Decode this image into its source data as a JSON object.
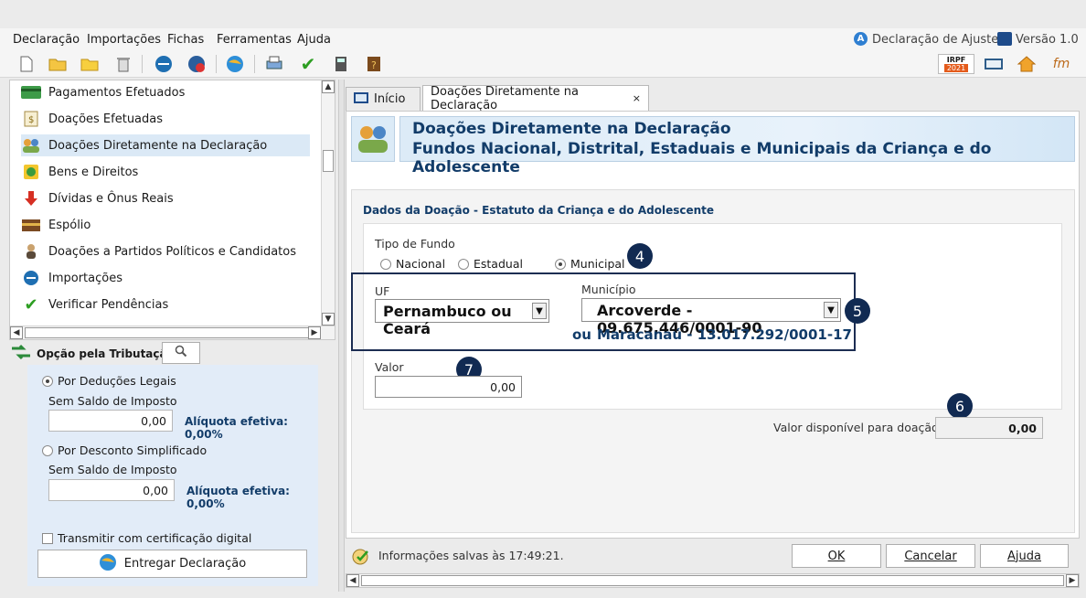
{
  "menu": {
    "items": [
      "Declaração",
      "Importações",
      "Fichas",
      "Ferramentas",
      "Ajuda"
    ],
    "right_decl": "Declaração de Ajuste",
    "right_version": "Versão 1.0"
  },
  "toolbar": {
    "irpf_label": "IRPF",
    "irpf_year": "2021"
  },
  "nav": {
    "items": [
      {
        "label": "Pagamentos Efetuados",
        "icon": "credit-card-icon"
      },
      {
        "label": "Doações Efetuadas",
        "icon": "money-bag-icon"
      },
      {
        "label": "Doações Diretamente na Declaração",
        "icon": "people-icon"
      },
      {
        "label": "Bens e Direitos",
        "icon": "coin-icon"
      },
      {
        "label": "Dívidas e Ônus Reais",
        "icon": "down-arrow-icon"
      },
      {
        "label": "Espólio",
        "icon": "chest-icon"
      },
      {
        "label": "Doações a Partidos Políticos e Candidatos",
        "icon": "person-icon"
      },
      {
        "label": "Importações",
        "icon": "import-icon"
      },
      {
        "label": "Verificar Pendências",
        "icon": "check-icon"
      }
    ],
    "selected_index": 2
  },
  "tributacao": {
    "title": "Opção pela Tributação:",
    "deducoes_label": "Por Deduções Legais",
    "saldo1_label": "Sem Saldo de Imposto",
    "saldo1_value": "0,00",
    "aliquota1": "Alíquota efetiva: 0,00%",
    "simplificado_label": "Por Desconto Simplificado",
    "saldo2_label": "Sem Saldo de Imposto",
    "saldo2_value": "0,00",
    "aliquota2": "Alíquota efetiva: 0,00%",
    "cert_label": "Transmitir com certificação digital",
    "entregar_label": "Entregar Declaração"
  },
  "tabs": [
    {
      "label": "Início"
    },
    {
      "label": "Doações Diretamente na Declaração",
      "close": "×"
    }
  ],
  "banner": {
    "line1": "Doações Diretamente na Declaração",
    "line2": "Fundos Nacional, Distrital, Estaduais e Municipais da Criança e do Adolescente"
  },
  "form": {
    "section_title": "Dados da Doação - Estatuto da Criança e do Adolescente",
    "tipo_label": "Tipo de Fundo",
    "radio_nacional": "Nacional",
    "radio_estadual": "Estadual",
    "radio_municipal": "Municipal",
    "selected_fundo": "Municipal",
    "uf_label": "UF",
    "uf_value": "Pernambuco ou Ceará",
    "municipio_label": "Município",
    "municipio_value": "Arcoverde - 09.675.446/0001-90",
    "ou_label": "ou",
    "municipio_alt": "Maracanaú - 13.017.292/0001-17",
    "valor_label": "Valor",
    "valor_value": "0,00",
    "disponivel_label": "Valor disponível para doação:",
    "disponivel_value": "0,00"
  },
  "callouts": {
    "c4": "4",
    "c5": "5",
    "c6": "6",
    "c7": "7"
  },
  "status": {
    "saved_text": "Informações salvas às 17:49:21."
  },
  "buttons": {
    "ok": "OK",
    "cancelar": "Cancelar",
    "ajuda": "Ajuda"
  },
  "colors": {
    "accent": "#123c69",
    "callout": "#112a52",
    "selection": "#dbe9f6"
  }
}
